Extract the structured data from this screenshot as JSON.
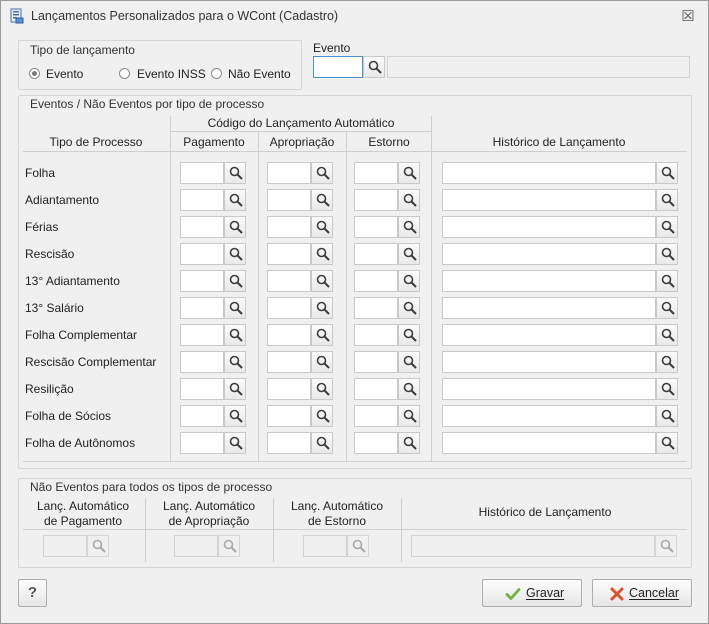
{
  "window": {
    "title": "Lançamentos Personalizados para o WCont (Cadastro)",
    "close": "☒"
  },
  "tipo_lancamento": {
    "legend": "Tipo de lançamento",
    "options": [
      {
        "label": "Evento",
        "selected": true
      },
      {
        "label": "Evento INSS",
        "selected": false
      },
      {
        "label": "Não Evento",
        "selected": false
      }
    ]
  },
  "evento": {
    "label": "Evento",
    "code_value": "",
    "description_value": ""
  },
  "por_processo": {
    "legend": "Eventos / Não Eventos por tipo de processo",
    "group_header": "Código do Lançamento Automático",
    "columns": {
      "tipo": "Tipo de Processo",
      "pagamento": "Pagamento",
      "apropriacao": "Apropriação",
      "estorno": "Estorno",
      "historico": "Histórico de Lançamento"
    },
    "rows": [
      {
        "label": "Folha"
      },
      {
        "label": "Adiantamento"
      },
      {
        "label": "Férias"
      },
      {
        "label": "Rescisão"
      },
      {
        "label": "13° Adiantamento"
      },
      {
        "label": "13° Salário"
      },
      {
        "label": "Folha Complementar"
      },
      {
        "label": "Rescisão Complementar"
      },
      {
        "label": "Resilição"
      },
      {
        "label": "Folha de Sócios"
      },
      {
        "label": "Folha de Autônomos"
      }
    ]
  },
  "todos_processos": {
    "legend": "Não Eventos para todos os tipos de processo",
    "columns": {
      "pagamento_l1": "Lanç. Automático",
      "pagamento_l2": "de Pagamento",
      "apropriacao_l1": "Lanç. Automático",
      "apropriacao_l2": "de Apropriação",
      "estorno_l1": "Lanç. Automático",
      "estorno_l2": "de Estorno",
      "historico": "Histórico de Lançamento"
    }
  },
  "buttons": {
    "help": "?",
    "gravar": "Gravar",
    "cancelar": "Cancelar"
  },
  "icons": {
    "search": "magnifier-icon",
    "gravar": "check-icon",
    "cancelar": "x-icon"
  },
  "colors": {
    "check": "#6cb33f",
    "cancel": "#d9532c"
  }
}
